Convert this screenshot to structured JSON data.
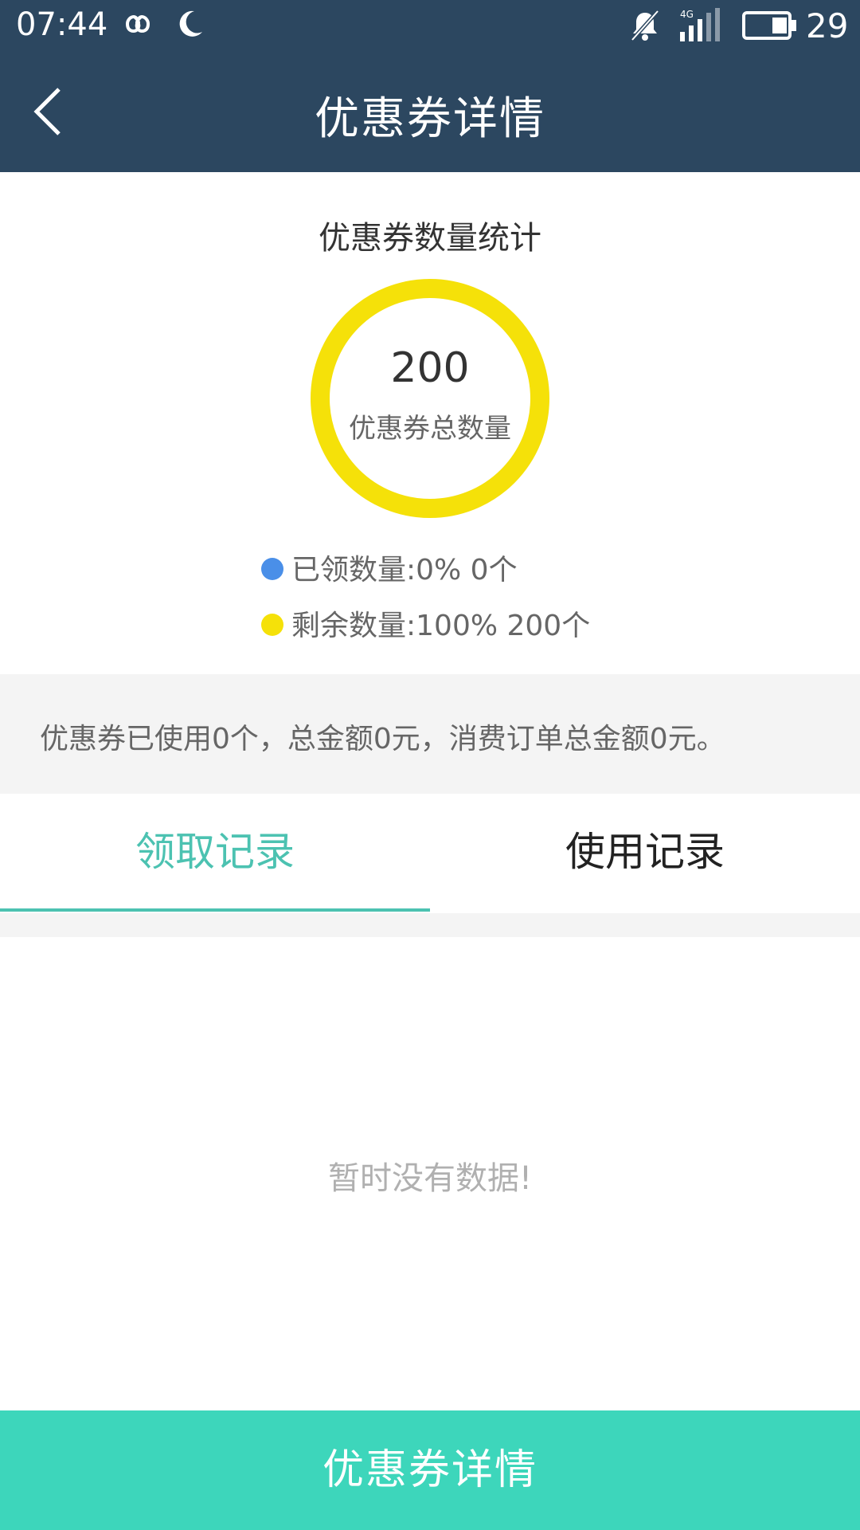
{
  "status_bar": {
    "time": "07:44",
    "battery_level": "29",
    "network": "4G"
  },
  "header": {
    "title": "优惠券详情",
    "back_icon": "chevron-left-icon"
  },
  "stats": {
    "title": "优惠券数量统计",
    "total": "200",
    "total_label": "优惠券总数量",
    "legend": [
      {
        "text": "已领数量:0%  0个",
        "color": "#4a8fe8",
        "percent": 0
      },
      {
        "text": "剩余数量:100%  200个",
        "color": "#f5e109",
        "percent": 100
      }
    ]
  },
  "summary": {
    "text": "优惠券已使用0个，总金额0元，消费订单总金额0元。"
  },
  "tabs": [
    {
      "label": "领取记录",
      "active": true
    },
    {
      "label": "使用记录",
      "active": false
    }
  ],
  "empty_state": {
    "text": "暂时没有数据!"
  },
  "bottom_button": {
    "label": "优惠券详情"
  },
  "colors": {
    "header_bg": "#2c4760",
    "accent_teal": "#4cc2b1",
    "bottom_button_bg": "#3dd6bb",
    "ring_yellow": "#f5e109",
    "legend_blue": "#4a8fe8"
  }
}
